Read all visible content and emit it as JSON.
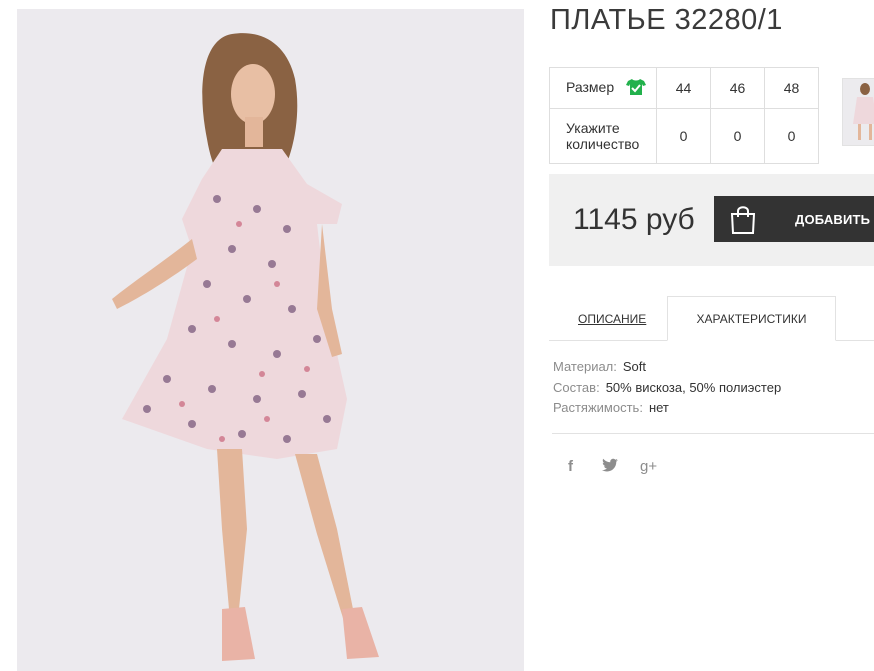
{
  "product": {
    "title": "ПЛАТЬЕ 32280/1",
    "image": "product-photo"
  },
  "sizes": {
    "row_label": "Размер",
    "qty_label": "Укажите количество",
    "values": [
      "44",
      "46",
      "48"
    ],
    "quantities": [
      "0",
      "0",
      "0"
    ],
    "icon": "green-tshirt-check-icon"
  },
  "price": {
    "amount": "1145 руб",
    "add_button": "ДОБАВИТЬ В",
    "icon": "shopping-bag-icon"
  },
  "tabs": [
    {
      "label": "ОПИСАНИЕ"
    },
    {
      "label": "ХАРАКТЕРИСТИКИ"
    }
  ],
  "specs": [
    {
      "key": "Материал:",
      "value": "Soft"
    },
    {
      "key": "Состав:",
      "value": "50% вискоза, 50% полиэстер"
    },
    {
      "key": "Растяжимость:",
      "value": "нет"
    }
  ],
  "social": {
    "facebook": "f",
    "twitter": "twitter-icon",
    "google": "g+"
  },
  "colors": {
    "button": "#333333",
    "box": "#f0f0f0",
    "accent_green": "#22b14c"
  }
}
